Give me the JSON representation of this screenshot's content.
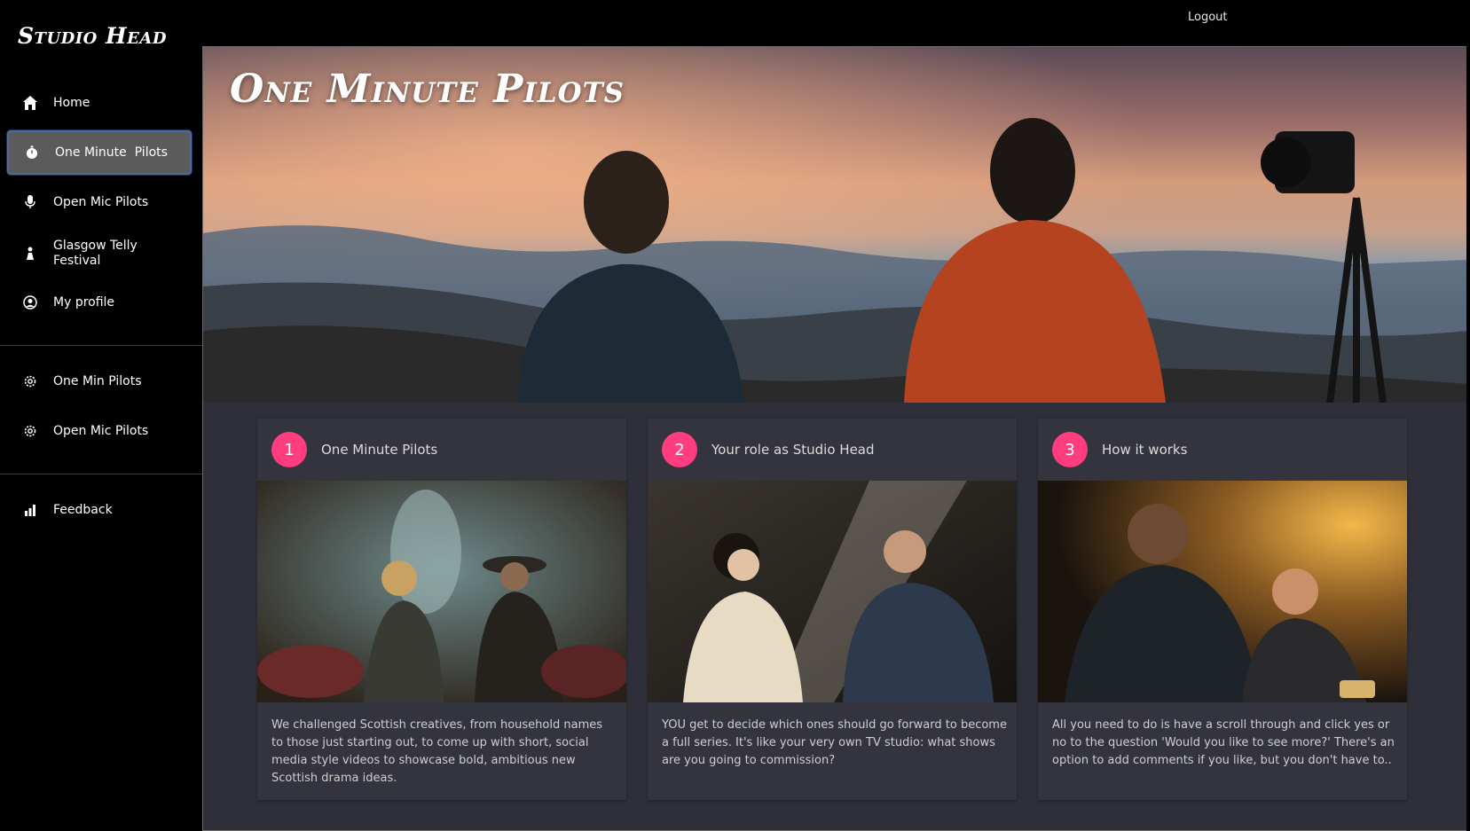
{
  "app": {
    "brand": "Studio Head"
  },
  "topbar": {
    "logout_label": "Logout"
  },
  "sidebar": {
    "primary": [
      {
        "label": "Home",
        "icon": "home-icon"
      },
      {
        "label": "One Minute  Pilots",
        "icon": "stopwatch-icon",
        "active": true
      },
      {
        "label": "Open Mic Pilots",
        "icon": "microphone-icon"
      },
      {
        "label": "Glasgow Telly Festival",
        "icon": "person-icon"
      },
      {
        "label": "My profile",
        "icon": "user-circle-icon"
      }
    ],
    "secondary": [
      {
        "label": "One Min Pilots",
        "icon": "gear-icon"
      },
      {
        "label": "Open Mic Pilots",
        "icon": "gear-icon"
      }
    ],
    "tertiary": [
      {
        "label": "Feedback",
        "icon": "bar-chart-icon"
      }
    ]
  },
  "hero": {
    "title": "One Minute Pilots"
  },
  "cards": [
    {
      "number": "1",
      "title": "One Minute Pilots",
      "text": "We challenged Scottish creatives, from household names to those just starting out, to come up with short, social media style videos to showcase bold, ambitious new Scottish drama ideas."
    },
    {
      "number": "2",
      "title": "Your role as Studio Head",
      "text": "YOU get to decide which ones should go forward to become a full series. It's like your very own TV studio: what shows are you going to commission?"
    },
    {
      "number": "3",
      "title": "How it works",
      "text": "All you need to do is have a scroll through and click yes or no to the question 'Would you like to see more?' There's an option to add comments if you like, but you don't have to.."
    }
  ],
  "colors": {
    "accent": "#ff3d7f",
    "panel": "#2e2f38",
    "active_nav": "#5b5b5b"
  }
}
